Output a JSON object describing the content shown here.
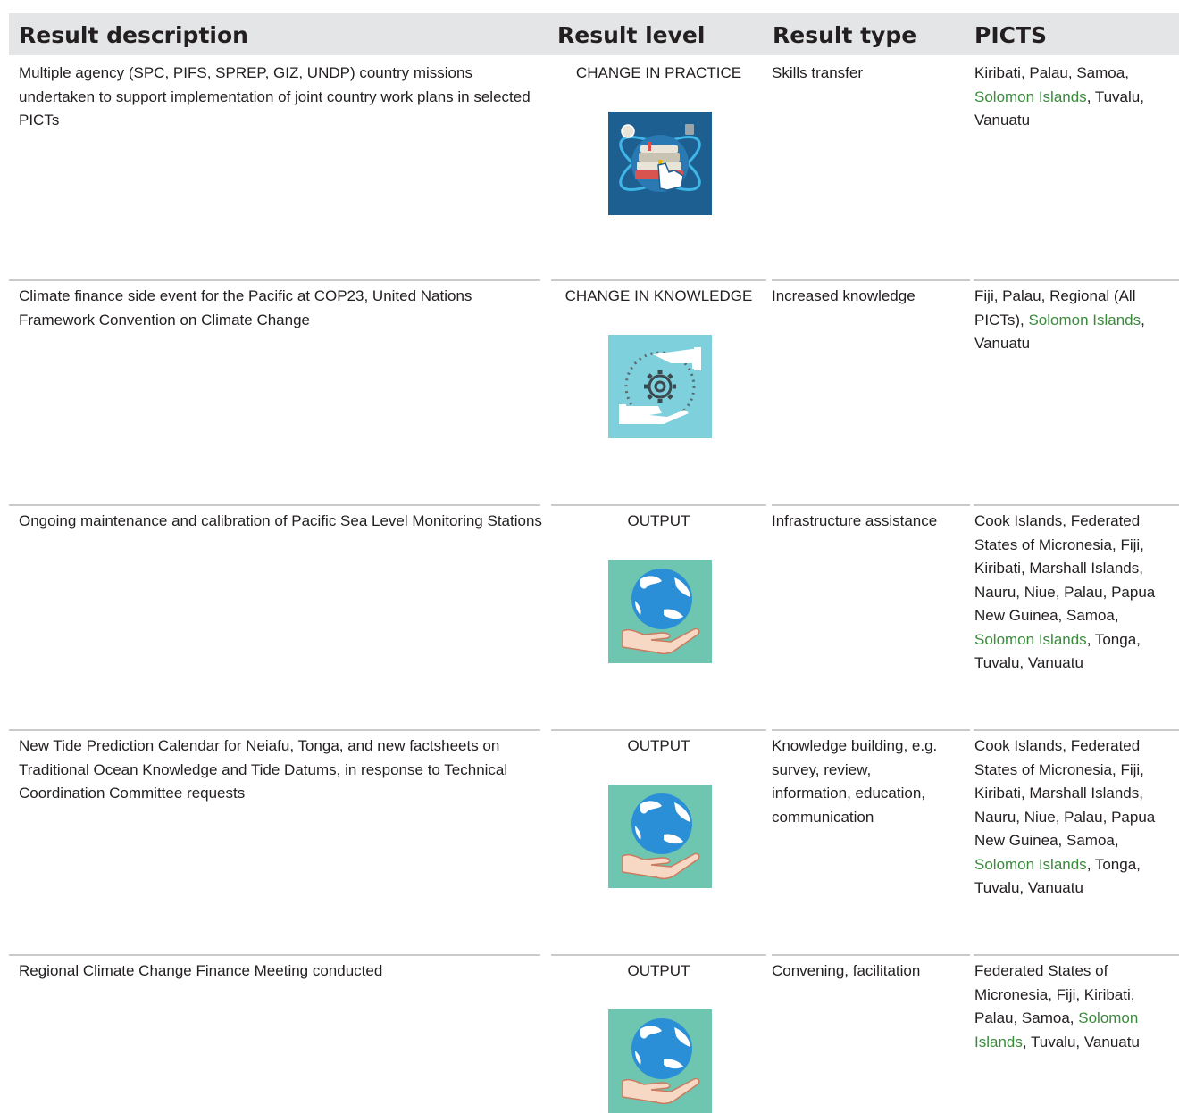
{
  "header": {
    "description": "Result description",
    "level": "Result level",
    "type": "Result type",
    "picts": "PICTS"
  },
  "rows": [
    {
      "description": "Multiple agency (SPC, PIFS, SPREP, GIZ, UNDP) country missions undertaken to support implementation of joint country work plans in selected PICTs",
      "level": "CHANGE IN PRACTICE",
      "icon": "skills-transfer-books-icon",
      "type": "Skills transfer",
      "picts_before": "Kiribati, Palau, Samoa, ",
      "picts_highlight": "Solomon Islands",
      "picts_after": ", Tuvalu, Vanuatu"
    },
    {
      "description": "Climate finance side event for the Pacific at COP23,  United Nations Framework Convention on Climate Change",
      "level": "CHANGE IN KNOWLEDGE",
      "icon": "hands-gear-icon",
      "type": "Increased knowledge",
      "picts_before": "Fiji, Palau, Regional (All PICTs), ",
      "picts_highlight": "Solomon Islands",
      "picts_after": ", Vanuatu"
    },
    {
      "description": "Ongoing maintenance and calibration of Pacific Sea Level Monitoring Stations",
      "level": "OUTPUT",
      "icon": "globe-in-hand-icon",
      "type": "Infrastructure assistance",
      "picts_before": "Cook Islands, Federated States of Micronesia, Fiji, Kiribati, Marshall Islands, Nauru, Niue, Palau, Papua New Guinea, Samoa, ",
      "picts_highlight": "Solomon Islands",
      "picts_after": ", Tonga, Tuvalu, Vanuatu"
    },
    {
      "description": "New Tide Prediction Calendar for Neiafu, Tonga, and new factsheets on Traditional Ocean Knowledge and Tide Datums, in response to Technical Coordination Committee requests",
      "level": "OUTPUT",
      "icon": "globe-in-hand-icon",
      "type": "Knowledge building, e.g. survey, review, information, education, communication",
      "picts_before": "Cook Islands, Federated States of Micronesia, Fiji, Kiribati, Marshall Islands, Nauru, Niue, Palau, Papua New Guinea, Samoa, ",
      "picts_highlight": "Solomon Islands",
      "picts_after": ", Tonga, Tuvalu, Vanuatu"
    },
    {
      "description": "Regional Climate Change Finance Meeting conducted",
      "level": "OUTPUT",
      "icon": "globe-in-hand-icon",
      "type": "Convening, facilitation",
      "picts_before": "Federated States of Micronesia, Fiji, Kiribati, Palau, Samoa, ",
      "picts_highlight": "Solomon Islands",
      "picts_after": ", Tuvalu, Vanuatu"
    }
  ],
  "colors": {
    "header_bg": "#e4e5e6",
    "highlight": "#3b8a3c",
    "skills_icon_bg": "#1e5f92",
    "knowledge_icon_bg": "#7dd0dc",
    "output_icon_bg": "#6fc6b0"
  }
}
